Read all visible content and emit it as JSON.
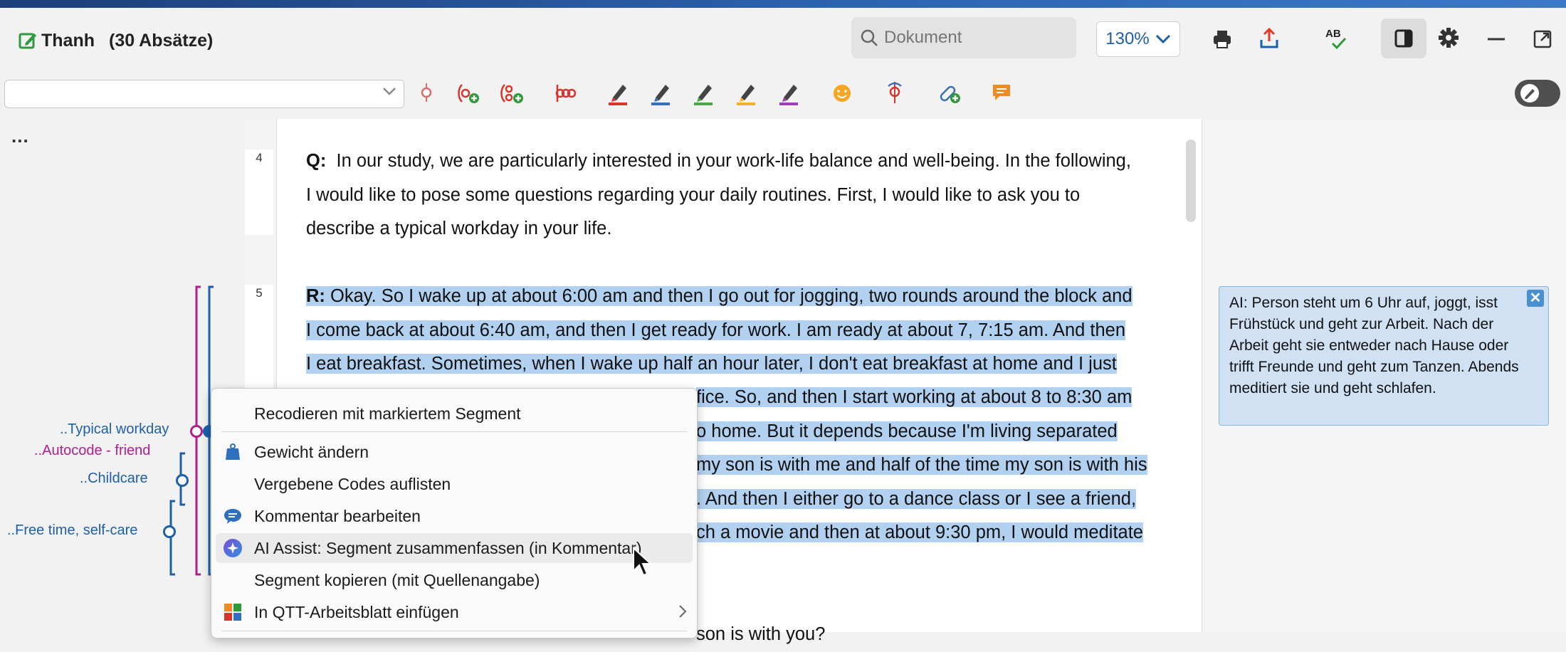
{
  "window": {
    "doc_name": "Thanh",
    "paragraph_count": "(30 Absätze)",
    "search_placeholder": "Dokument",
    "zoom": "130%"
  },
  "toolbar_icons": [
    "edit-doc-icon",
    "search-icon",
    "print-icon",
    "export-icon",
    "spellcheck-icon",
    "sidebar-toggle-icon",
    "settings-icon",
    "minimize-icon",
    "popout-icon"
  ],
  "code_toolbar": {
    "select_value": "",
    "highlight_colors": [
      "#d9332b",
      "#3b6fb5",
      "#4fa34a",
      "#f0b429",
      "#9b3fb5"
    ]
  },
  "left_pane": {
    "more": "...",
    "codes": [
      {
        "label": "..Typical workday",
        "color": "#1d5fa8"
      },
      {
        "label": "..Autocode - friend",
        "color": "#b0208f"
      },
      {
        "label": "..Childcare",
        "color": "#1d5fa8"
      },
      {
        "label": "..Free time, self-care",
        "color": "#1d5fa8"
      }
    ]
  },
  "document": {
    "paragraphs": [
      {
        "number": "4",
        "speaker": "Q:",
        "lines": [
          "In our study, we are particularly interested in your work-life balance and well-being. In the following,",
          "I would like to pose some questions regarding your daily routines. First, I would like to ask you to",
          "describe a typical workday in your life."
        ]
      },
      {
        "number": "5",
        "speaker": "R:",
        "lines": [
          "Okay. So I wake up at about 6:00 am and then I go out for jogging, two rounds around the block and",
          "I come back at about 6:40 am, and then I get ready for work. I am ready at about 7, 7:15 am. And then",
          "I eat breakfast. Sometimes, when I wake up half an hour later, I don't eat breakfast at home and I just",
          "fice. So, and then I start working at about 8 to 8:30 am",
          "o home. But it depends because I'm living separated",
          "my son is with me and half of the time my son is with his",
          ". And then I either go to a dance class or I see a friend,",
          "ch a movie and then at about 9:30 pm, I would meditate",
          "son is with you?"
        ]
      }
    ]
  },
  "comment": {
    "text": "AI: Person steht um 6 Uhr auf, joggt, isst Frühstück und geht zur Arbeit. Nach der Arbeit geht sie entweder nach Hause oder trifft Freunde und geht zum Tanzen. Abends meditiert sie und geht schlafen.",
    "close": "✕"
  },
  "context_menu": {
    "items": [
      {
        "label": "Recodieren mit markiertem Segment",
        "icon": ""
      },
      {
        "label": "Gewicht ändern",
        "icon": "weight-icon"
      },
      {
        "label": "Vergebene Codes auflisten",
        "icon": ""
      },
      {
        "label": "Kommentar bearbeiten",
        "icon": "comment-icon"
      },
      {
        "label": "AI Assist: Segment zusammenfassen (in Kommentar)",
        "icon": "ai-assist-icon"
      },
      {
        "label": "Segment kopieren (mit Quellenangabe)",
        "icon": ""
      },
      {
        "label": "In QTT-Arbeitsblatt einfügen",
        "icon": "qtt-worksheet-icon"
      }
    ],
    "hovered_index": 4
  }
}
